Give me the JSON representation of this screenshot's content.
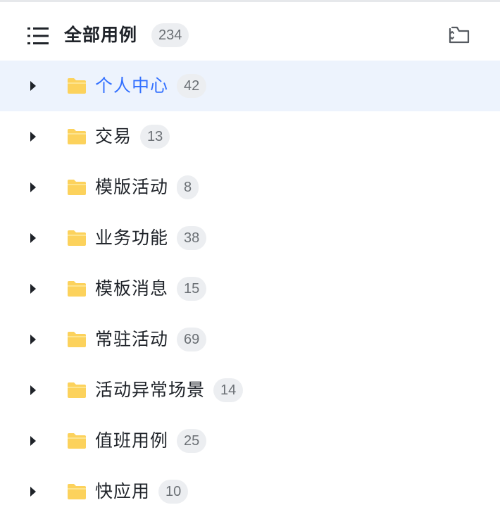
{
  "header": {
    "title": "全部用例",
    "count": "234",
    "list_icon": "list-icon",
    "action_icon": "folder-sync-icon"
  },
  "tree": {
    "items": [
      {
        "label": "个人中心",
        "count": "42",
        "selected": true
      },
      {
        "label": "交易",
        "count": "13",
        "selected": false
      },
      {
        "label": "模版活动",
        "count": "8",
        "selected": false
      },
      {
        "label": "业务功能",
        "count": "38",
        "selected": false
      },
      {
        "label": "模板消息",
        "count": "15",
        "selected": false
      },
      {
        "label": "常驻活动",
        "count": "69",
        "selected": false
      },
      {
        "label": "活动异常场景",
        "count": "14",
        "selected": false
      },
      {
        "label": "值班用例",
        "count": "25",
        "selected": false
      },
      {
        "label": "快应用",
        "count": "10",
        "selected": false
      }
    ],
    "folder_icon": "folder-icon",
    "caret_icon": "caret-right-icon"
  },
  "colors": {
    "accent": "#3370ff",
    "selected_bg": "#edf3fd",
    "folder": "#fcd25c",
    "badge_bg": "#eceef1",
    "text": "#1f2329"
  }
}
